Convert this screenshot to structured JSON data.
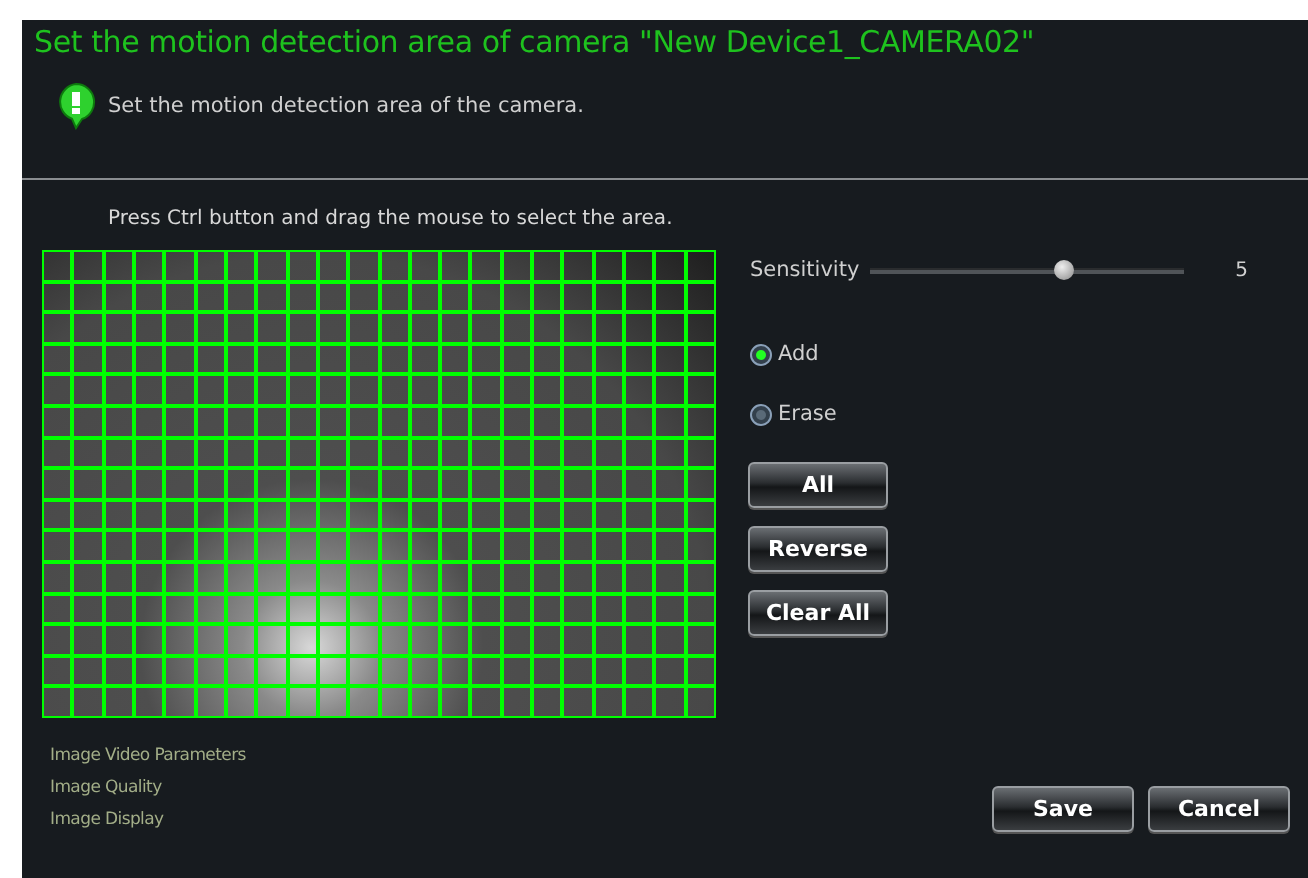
{
  "window": {
    "title": "Set the motion detection area of camera \"New Device1_CAMERA02\""
  },
  "hint": "Set the motion detection area of the camera.",
  "instruction": "Press Ctrl button and drag the mouse to select the area.",
  "motion_grid": {
    "rows": [
      [
        true,
        true,
        true,
        true,
        true,
        true,
        true,
        true,
        true,
        true,
        true,
        true,
        true,
        true,
        true,
        true,
        true,
        true,
        true,
        true,
        true,
        true
      ],
      [
        true,
        true,
        true,
        true,
        true,
        true,
        true,
        true,
        true,
        true,
        true,
        true,
        true,
        true,
        true,
        true,
        true,
        true,
        true,
        true,
        true,
        true
      ],
      [
        true,
        true,
        true,
        true,
        true,
        true,
        true,
        true,
        true,
        true,
        true,
        true,
        true,
        true,
        true,
        true,
        true,
        true,
        true,
        true,
        true,
        true
      ],
      [
        true,
        true,
        true,
        true,
        true,
        true,
        true,
        true,
        true,
        true,
        true,
        true,
        true,
        true,
        true,
        true,
        true,
        true,
        true,
        true,
        true,
        true
      ],
      [
        true,
        true,
        true,
        true,
        true,
        true,
        true,
        true,
        true,
        true,
        true,
        true,
        true,
        true,
        true,
        true,
        true,
        true,
        true,
        true,
        true,
        true
      ],
      [
        true,
        true,
        true,
        true,
        true,
        true,
        true,
        true,
        true,
        true,
        true,
        true,
        true,
        true,
        true,
        true,
        true,
        true,
        true,
        true,
        true,
        true
      ],
      [
        true,
        true,
        true,
        true,
        true,
        true,
        true,
        true,
        true,
        true,
        true,
        true,
        true,
        true,
        true,
        true,
        true,
        true,
        true,
        true,
        true,
        true
      ],
      [
        true,
        true,
        true,
        true,
        true,
        true,
        true,
        true,
        true,
        true,
        true,
        true,
        true,
        true,
        true,
        true,
        true,
        true,
        true,
        true,
        true,
        true
      ],
      [
        true,
        true,
        true,
        true,
        true,
        true,
        true,
        true,
        true,
        true,
        true,
        true,
        true,
        true,
        true,
        true,
        true,
        true,
        true,
        true,
        true,
        true
      ],
      [
        true,
        true,
        true,
        true,
        true,
        true,
        true,
        true,
        true,
        true,
        true,
        true,
        true,
        true,
        true,
        true,
        true,
        true,
        true,
        true,
        true,
        true
      ],
      [
        true,
        true,
        true,
        true,
        true,
        true,
        true,
        true,
        true,
        true,
        true,
        true,
        true,
        true,
        true,
        true,
        true,
        true,
        true,
        true,
        true,
        true
      ],
      [
        true,
        true,
        true,
        true,
        true,
        true,
        true,
        true,
        true,
        true,
        true,
        true,
        true,
        true,
        true,
        true,
        true,
        true,
        true,
        true,
        true,
        true
      ],
      [
        true,
        true,
        true,
        true,
        true,
        true,
        true,
        true,
        true,
        true,
        true,
        true,
        true,
        true,
        true,
        true,
        true,
        true,
        true,
        true,
        true,
        true
      ],
      [
        true,
        true,
        true,
        true,
        true,
        true,
        true,
        true,
        true,
        true,
        true,
        true,
        true,
        true,
        true,
        true,
        true,
        true,
        true,
        true,
        true,
        true
      ],
      [
        true,
        true,
        true,
        true,
        true,
        true,
        true,
        true,
        true,
        true,
        true,
        true,
        true,
        true,
        true,
        true,
        true,
        true,
        true,
        true,
        true,
        true
      ]
    ]
  },
  "sensitivity": {
    "label": "Sensitivity",
    "level": 0.62,
    "reading": "5"
  },
  "modes": [
    {
      "label": "Add",
      "selected": true
    },
    {
      "label": "Erase",
      "selected": false
    }
  ],
  "area_buttons": [
    "All",
    "Reverse",
    "Clear All"
  ],
  "links": [
    "Image Video Parameters",
    "Image Quality",
    "Image Display"
  ],
  "buttons": [
    "Save",
    "Cancel"
  ]
}
